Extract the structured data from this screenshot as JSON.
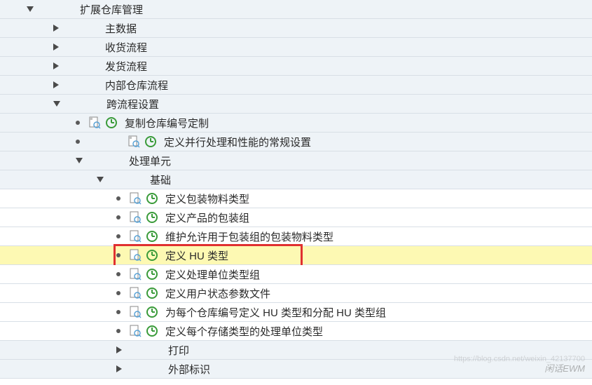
{
  "tree": {
    "root": "扩展仓库管理",
    "level2": {
      "master_data": "主数据",
      "inbound": "收货流程",
      "outbound": "发货流程",
      "internal": "内部仓库流程",
      "cross": "跨流程设置"
    },
    "level3": {
      "copy_wh": "复制仓库编号定制",
      "def_parallel": "定义并行处理和性能的常规设置",
      "hu": "处理单元"
    },
    "level4": {
      "basic": "基础"
    },
    "level5": {
      "def_pack_mat_type": "定义包装物料类型",
      "def_prod_pack_grp": "定义产品的包装组",
      "maint_allow": "维护允许用于包装组的包装物料类型",
      "def_hu_type": "定义 HU 类型",
      "def_hu_type_grp": "定义处理单位类型组",
      "def_user_status": "定义用户状态参数文件",
      "per_wh_assign": "为每个仓库编号定义 HU 类型和分配 HU 类型组",
      "def_storage_hu": "定义每个存储类型的处理单位类型",
      "print": "打印",
      "ext_id": "外部标识"
    }
  },
  "watermark": "闲话EWM",
  "watermark2": "https://blog.csdn.net/weixin_42137700"
}
